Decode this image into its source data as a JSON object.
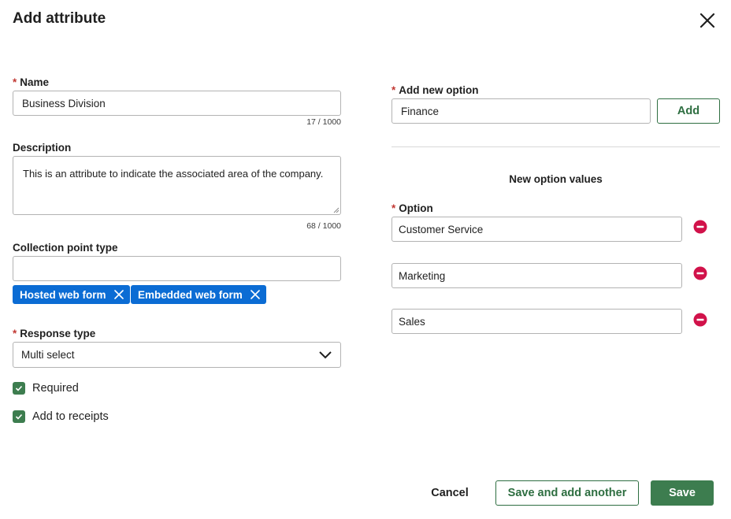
{
  "dialog": {
    "title": "Add attribute",
    "close_icon": "close-icon"
  },
  "name_field": {
    "label": "Name",
    "required": true,
    "value": "Business Division",
    "counter": "17 / 1000"
  },
  "description_field": {
    "label": "Description",
    "value": "This is an attribute to indicate the associated area of the company.",
    "counter": "68 / 1000"
  },
  "collection_point": {
    "label": "Collection point type",
    "value": "",
    "chips": [
      {
        "label": "Hosted web form"
      },
      {
        "label": "Embedded web form"
      }
    ]
  },
  "response_type": {
    "label": "Response type",
    "required": true,
    "selected": "Multi select"
  },
  "checkboxes": [
    {
      "label": "Required",
      "checked": true
    },
    {
      "label": "Add to receipts",
      "checked": true
    }
  ],
  "add_option": {
    "label": "Add new option",
    "required": true,
    "value": "Finance",
    "button_label": "Add"
  },
  "option_values": {
    "section_title": "New option values",
    "label": "Option",
    "required": true,
    "items": [
      {
        "value": "Customer Service"
      },
      {
        "value": "Marketing"
      },
      {
        "value": "Sales"
      }
    ]
  },
  "footer": {
    "cancel_label": "Cancel",
    "save_another_label": "Save and add another",
    "save_label": "Save"
  },
  "colors": {
    "primary_green": "#3d7d4f",
    "outline_green": "#2e6e41",
    "chip_blue": "#0b6cd4",
    "required_red": "#c23934",
    "remove_red": "#d1124a"
  }
}
